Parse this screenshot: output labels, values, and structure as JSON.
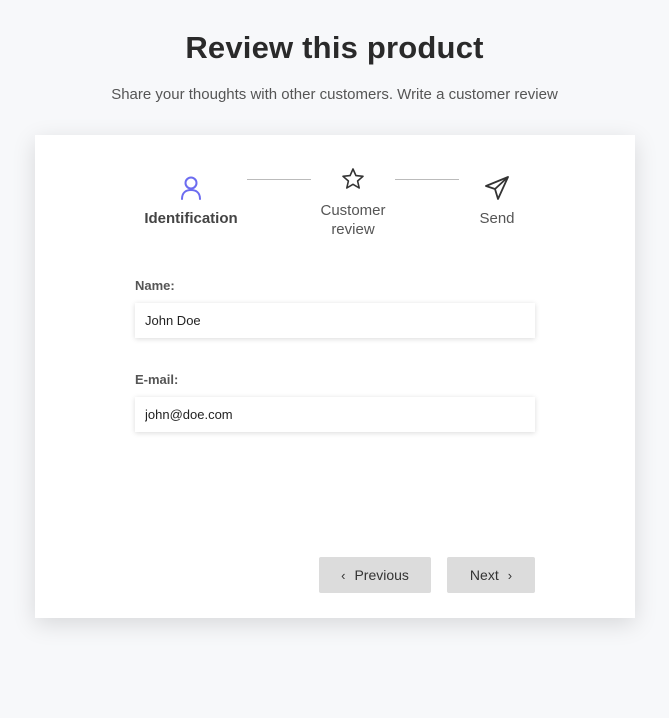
{
  "header": {
    "title": "Review this product",
    "subtitle": "Share your thoughts with other customers. Write a customer review"
  },
  "steps": [
    {
      "label": "Identification",
      "icon": "user-icon",
      "active": true
    },
    {
      "label": "Customer review",
      "icon": "star-icon",
      "active": false
    },
    {
      "label": "Send",
      "icon": "paper-plane-icon",
      "active": false
    }
  ],
  "form": {
    "name_label": "Name:",
    "name_value": "John Doe",
    "email_label": "E-mail:",
    "email_value": "john@doe.com"
  },
  "buttons": {
    "previous_label": "Previous",
    "next_label": "Next"
  },
  "colors": {
    "accent": "#6c6cf0",
    "background": "#f7f8fa",
    "button": "#dcdcdc"
  }
}
